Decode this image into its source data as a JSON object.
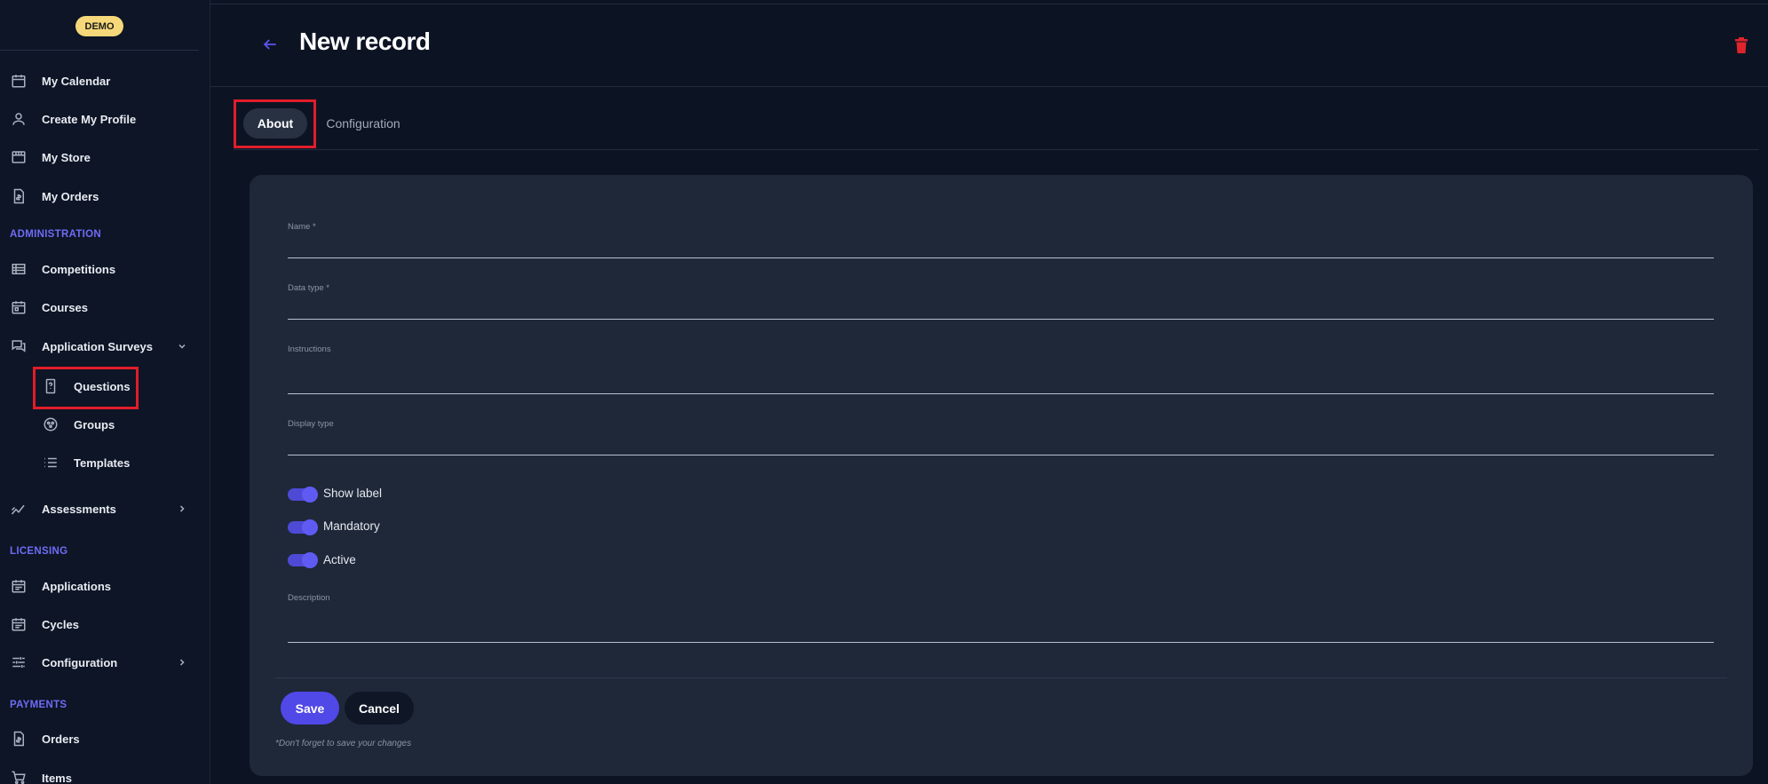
{
  "app": {
    "badge": "DEMO"
  },
  "sidebar": {
    "top_items": [
      {
        "label": "My Calendar",
        "icon": "calendar-icon"
      },
      {
        "label": "Create My Profile",
        "icon": "person-icon"
      },
      {
        "label": "My Store",
        "icon": "store-icon"
      },
      {
        "label": "My Orders",
        "icon": "receipt-icon"
      }
    ],
    "sections": {
      "administration": "ADMINISTRATION",
      "licensing": "LICENSING",
      "payments": "PAYMENTS"
    },
    "admin_items": [
      {
        "label": "Competitions",
        "icon": "list-icon"
      },
      {
        "label": "Courses",
        "icon": "calendar-icon"
      },
      {
        "label": "Application Surveys",
        "icon": "forum-icon"
      }
    ],
    "survey_sub_items": [
      {
        "label": "Questions",
        "icon": "question-icon"
      },
      {
        "label": "Groups",
        "icon": "groups-icon"
      },
      {
        "label": "Templates",
        "icon": "list-bullets-icon"
      }
    ],
    "assessments": {
      "label": "Assessments",
      "icon": "trend-icon"
    },
    "licensing_items": [
      {
        "label": "Applications",
        "icon": "event-note-icon"
      },
      {
        "label": "Cycles",
        "icon": "event-note-icon"
      },
      {
        "label": "Configuration",
        "icon": "tune-icon"
      }
    ],
    "payments_items": [
      {
        "label": "Orders",
        "icon": "receipt-icon"
      },
      {
        "label": "Items",
        "icon": "cart-icon"
      }
    ]
  },
  "header": {
    "title": "New record"
  },
  "tabs": {
    "about": "About",
    "configuration": "Configuration"
  },
  "form": {
    "name_label": "Name *",
    "data_type_label": "Data type *",
    "instructions_label": "Instructions",
    "display_type_label": "Display type",
    "toggles": {
      "show_label": "Show label",
      "mandatory": "Mandatory",
      "active": "Active"
    },
    "description_label": "Description",
    "save": "Save",
    "cancel": "Cancel",
    "note": "*Don't forget to save your changes"
  },
  "colors": {
    "accent": "#5148e8",
    "highlight": "#e11d2a",
    "badge": "#f6d87a"
  }
}
